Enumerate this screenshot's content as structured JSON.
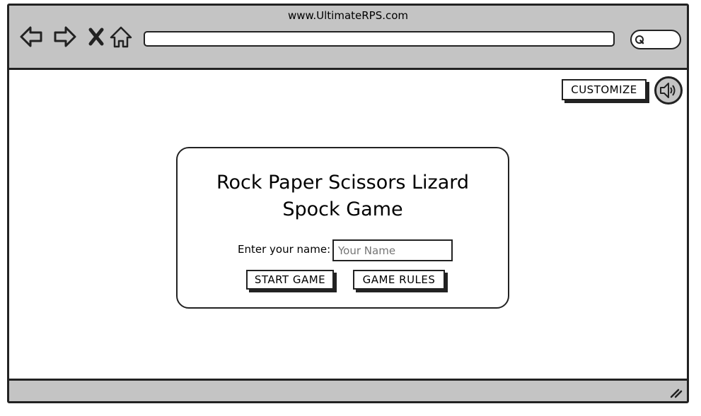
{
  "browser": {
    "url_title": "www.UltimateRPS.com",
    "address_value": "",
    "icons": [
      "back-arrow-icon",
      "forward-arrow-icon",
      "close-x-icon",
      "home-icon",
      "search-icon"
    ]
  },
  "toolbar": {
    "customize_label": "CUSTOMIZE",
    "sound_icon": "speaker-icon"
  },
  "card": {
    "title": "Rock Paper Scissors Lizard Spock Game",
    "name_label": "Enter your name:",
    "name_placeholder": "Your Name",
    "start_label": "START GAME",
    "rules_label": "GAME RULES"
  },
  "colors": {
    "chrome_gray": "#c4c4c4",
    "ink": "#222222",
    "background": "#ffffff"
  }
}
